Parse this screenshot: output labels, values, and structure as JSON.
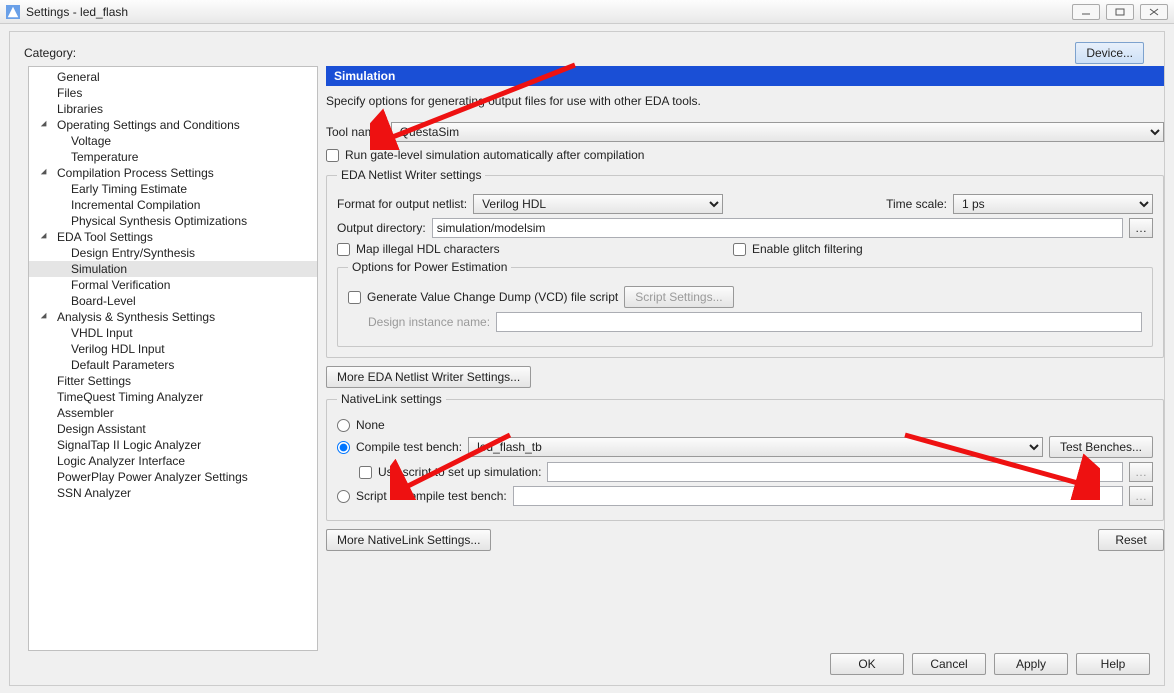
{
  "window": {
    "title": "Settings - led_flash"
  },
  "category_label": "Category:",
  "device_button": "Device...",
  "tree": [
    {
      "label": "General",
      "depth": 1
    },
    {
      "label": "Files",
      "depth": 1
    },
    {
      "label": "Libraries",
      "depth": 1
    },
    {
      "label": "Operating Settings and Conditions",
      "depth": 1,
      "caret": true
    },
    {
      "label": "Voltage",
      "depth": 2
    },
    {
      "label": "Temperature",
      "depth": 2
    },
    {
      "label": "Compilation Process Settings",
      "depth": 1,
      "caret": true
    },
    {
      "label": "Early Timing Estimate",
      "depth": 2
    },
    {
      "label": "Incremental Compilation",
      "depth": 2
    },
    {
      "label": "Physical Synthesis Optimizations",
      "depth": 2
    },
    {
      "label": "EDA Tool Settings",
      "depth": 1,
      "caret": true
    },
    {
      "label": "Design Entry/Synthesis",
      "depth": 2
    },
    {
      "label": "Simulation",
      "depth": 2,
      "selected": true
    },
    {
      "label": "Formal Verification",
      "depth": 2
    },
    {
      "label": "Board-Level",
      "depth": 2
    },
    {
      "label": "Analysis & Synthesis Settings",
      "depth": 1,
      "caret": true
    },
    {
      "label": "VHDL Input",
      "depth": 2
    },
    {
      "label": "Verilog HDL Input",
      "depth": 2
    },
    {
      "label": "Default Parameters",
      "depth": 2
    },
    {
      "label": "Fitter Settings",
      "depth": 1
    },
    {
      "label": "TimeQuest Timing Analyzer",
      "depth": 1
    },
    {
      "label": "Assembler",
      "depth": 1
    },
    {
      "label": "Design Assistant",
      "depth": 1
    },
    {
      "label": "SignalTap II Logic Analyzer",
      "depth": 1
    },
    {
      "label": "Logic Analyzer Interface",
      "depth": 1
    },
    {
      "label": "PowerPlay Power Analyzer Settings",
      "depth": 1
    },
    {
      "label": "SSN Analyzer",
      "depth": 1
    }
  ],
  "panel": {
    "header": "Simulation",
    "description": "Specify options for generating output files for use with other EDA tools.",
    "tool_name_label": "Tool name:",
    "tool_name_value": "QuestaSim",
    "run_gate_level": "Run gate-level simulation automatically after compilation",
    "netlist": {
      "legend": "EDA Netlist Writer settings",
      "format_label": "Format for output netlist:",
      "format_value": "Verilog HDL",
      "timescale_label": "Time scale:",
      "timescale_value": "1 ps",
      "outdir_label": "Output directory:",
      "outdir_value": "simulation/modelsim",
      "map_illegal": "Map illegal HDL characters",
      "enable_glitch": "Enable glitch filtering",
      "power_legend": "Options for Power Estimation",
      "gen_vcd": "Generate Value Change Dump (VCD) file script",
      "script_settings_btn": "Script Settings...",
      "design_instance_label": "Design instance name:"
    },
    "more_netlist_btn": "More EDA Netlist Writer Settings...",
    "nativelink": {
      "legend": "NativeLink settings",
      "none": "None",
      "compile_tb": "Compile test bench:",
      "tb_value": "led_flash_tb",
      "test_benches_btn": "Test Benches...",
      "use_script": "Use script to set up simulation:",
      "script_to_compile": "Script to compile test bench:"
    },
    "more_nativelink_btn": "More NativeLink Settings...",
    "reset_btn": "Reset"
  },
  "footer": {
    "ok": "OK",
    "cancel": "Cancel",
    "apply": "Apply",
    "help": "Help"
  }
}
